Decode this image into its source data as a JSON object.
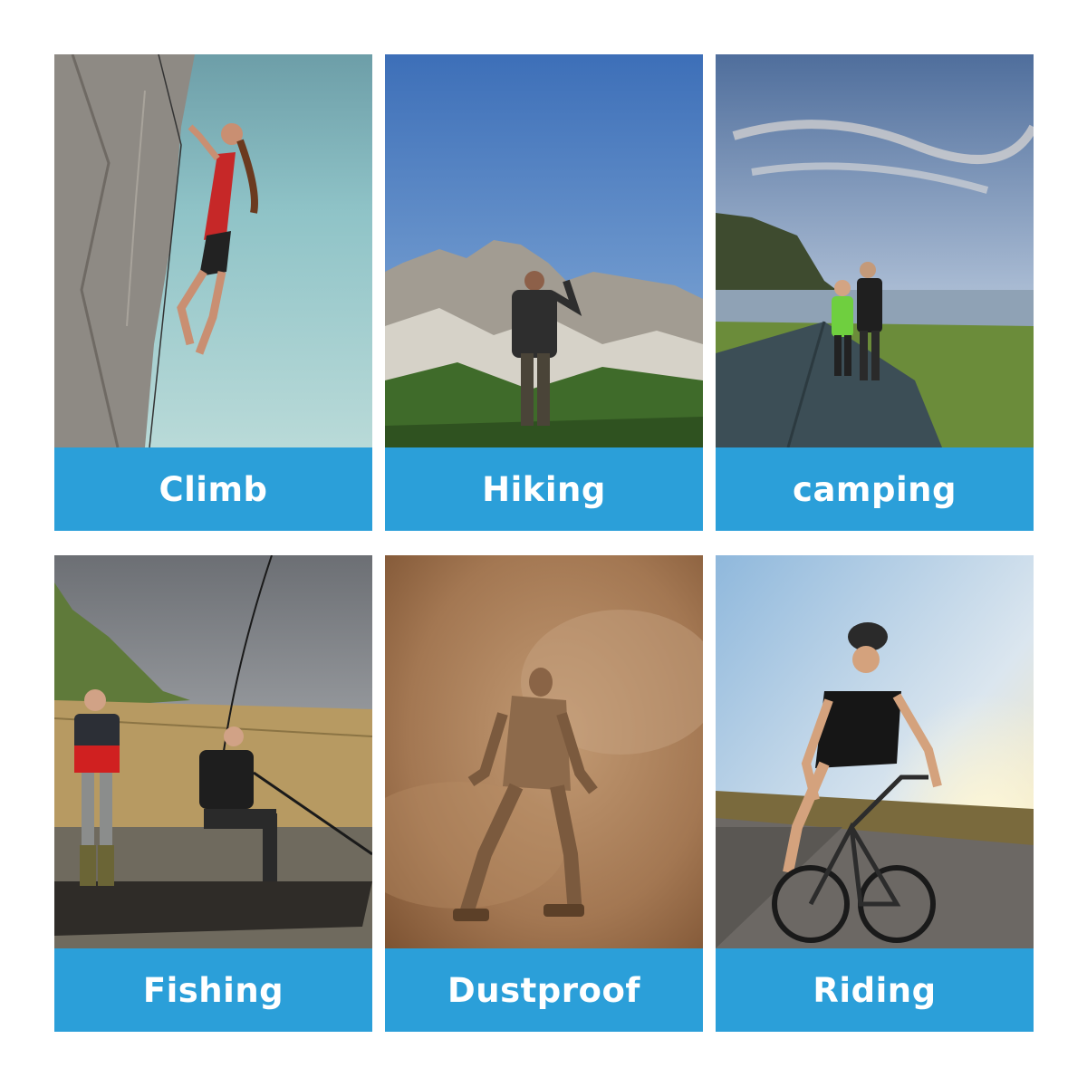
{
  "colors": {
    "label_bg": "#2b9fd9",
    "label_text": "#ffffff",
    "page_bg": "#ffffff"
  },
  "cards": [
    {
      "label": "Climb"
    },
    {
      "label": "Hiking"
    },
    {
      "label": "camping"
    },
    {
      "label": "Fishing"
    },
    {
      "label": "Dustproof"
    },
    {
      "label": "Riding"
    }
  ]
}
